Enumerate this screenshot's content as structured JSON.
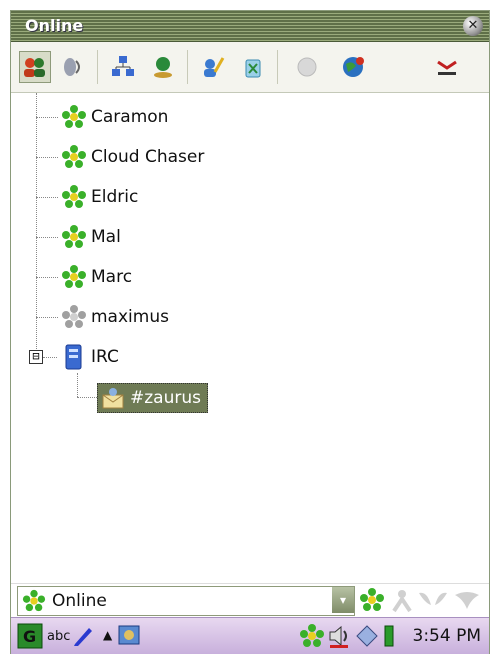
{
  "window": {
    "title": "Online"
  },
  "toolbar": {
    "buttons": [
      {
        "icon": "contacts-icon"
      },
      {
        "icon": "sound-icon"
      },
      {
        "icon": "network-icon"
      },
      {
        "icon": "user-globe-icon"
      },
      {
        "icon": "edit-user-icon"
      },
      {
        "icon": "delete-icon"
      },
      {
        "icon": "disabled-icon"
      },
      {
        "icon": "globe-icon"
      },
      {
        "icon": "away-icon"
      }
    ]
  },
  "tree": {
    "contacts": [
      {
        "name": "Caramon",
        "icon": "icq-online-icon"
      },
      {
        "name": "Cloud Chaser",
        "icon": "icq-online-icon"
      },
      {
        "name": "Eldric",
        "icon": "icq-online-icon"
      },
      {
        "name": "Mal",
        "icon": "icq-online-icon"
      },
      {
        "name": "Marc",
        "icon": "icq-online-icon"
      },
      {
        "name": "maximus",
        "icon": "icq-offline-icon"
      }
    ],
    "group": {
      "name": "IRC",
      "expander": "⊟",
      "icon": "irc-server-icon",
      "children": [
        {
          "name": "#zaurus",
          "icon": "irc-channel-icon"
        }
      ]
    }
  },
  "status": {
    "value": "Online",
    "dropdown_glyph": "▾"
  },
  "taskbar": {
    "input_mode": "abc",
    "up_arrow": "▲",
    "clock": "3:54 PM"
  },
  "colors": {
    "accent": "#6f7b55",
    "titlebar": "#5f7048",
    "taskbar": "#c8b0dc"
  }
}
